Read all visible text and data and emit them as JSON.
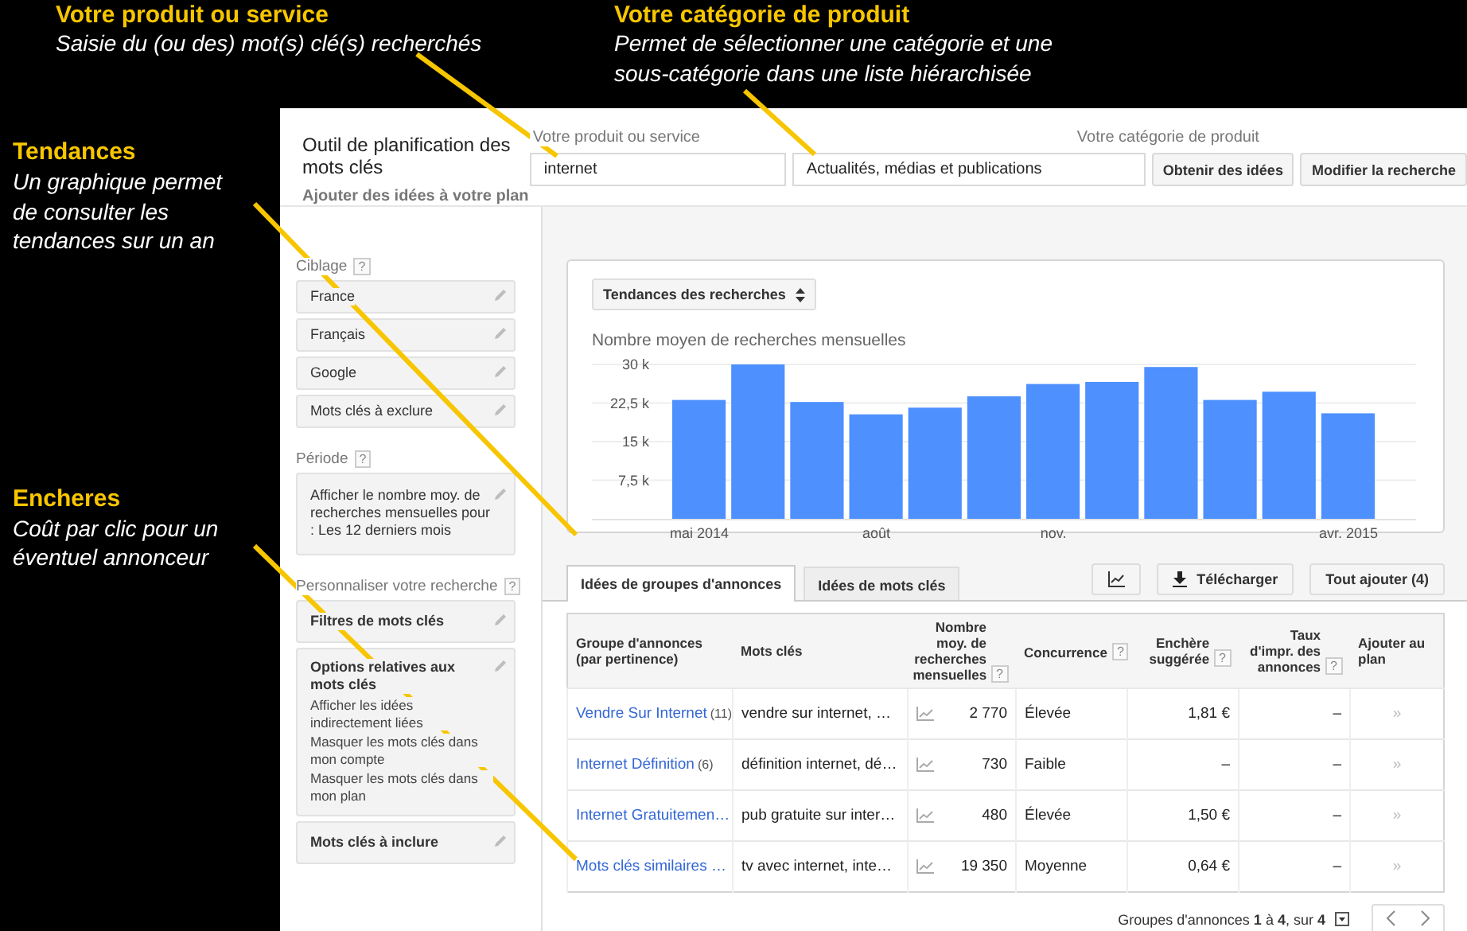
{
  "top_annotations": [
    {
      "title": "Votre produit ou service",
      "text": "Saisie du (ou des) mot(s) clé(s) recherchés"
    },
    {
      "title": "Votre catégorie de produit",
      "text": "Permet de sélectionner une catégorie et une sous-catégorie dans une liste hiérarchisée"
    }
  ],
  "side_annotations": [
    {
      "title": "Tendances",
      "text": "Un graphique permet de consulter les tendances sur un an"
    },
    {
      "title": "Encheres",
      "text": "Coût par clic pour un éventuel annonceur"
    }
  ],
  "header": {
    "title": "Outil de planification des mots clés",
    "subtitle": "Ajouter des idées à votre plan"
  },
  "search": {
    "product_label": "Votre produit ou service",
    "product_value": "internet",
    "category_label": "Votre catégorie de produit",
    "category_value": "Actualités, médias et publications",
    "buttons": [
      "Obtenir des idées",
      "Modifier la recherche"
    ]
  },
  "sidebar": {
    "sections": [
      {
        "title": "Ciblage",
        "help": "?",
        "items": [
          {
            "kind": "plain",
            "label": "France"
          },
          {
            "kind": "plain",
            "label": "Français"
          },
          {
            "kind": "plain",
            "label": "Google"
          },
          {
            "kind": "plain",
            "label": "Mots clés à exclure"
          }
        ]
      },
      {
        "title": "Période",
        "help": "?",
        "items": [
          {
            "kind": "plain",
            "label": "Afficher le nombre moy. de recherches mensuelles pour : Les 12 derniers mois"
          }
        ]
      },
      {
        "title": "Personnaliser votre recherche",
        "help": "?",
        "items": [
          {
            "kind": "bold",
            "label": "Filtres de mots clés"
          },
          {
            "kind": "options",
            "label": "Options relatives aux mots clés",
            "lines": [
              "Afficher les idées indirectement liées",
              "Masquer les mots clés dans mon compte",
              "Masquer les mots clés dans mon plan"
            ]
          },
          {
            "kind": "bold",
            "label": "Mots clés à inclure"
          }
        ]
      }
    ]
  },
  "chart": {
    "selector": "Tendances des recherches",
    "chart_data": {
      "type": "bar",
      "title": "Nombre moyen de recherches mensuelles",
      "categories": [
        "mai 2014",
        null,
        null,
        "août",
        null,
        null,
        "nov.",
        null,
        null,
        null,
        null,
        "avr. 2015"
      ],
      "series": [
        {
          "color": "#4d90fe",
          "values": [
            23.1,
            30,
            22.7,
            20.3,
            21.6,
            23.8,
            26.2,
            26.6,
            29.5,
            23.1,
            24.7,
            20.5
          ]
        }
      ],
      "ylim": [
        0,
        30
      ],
      "grid": true,
      "yticks": [
        {
          "value": 7.5,
          "label": "7,5 k"
        },
        {
          "value": 15,
          "label": "15 k"
        },
        {
          "value": 22.5,
          "label": "22,5 k"
        },
        {
          "value": 30,
          "label": "30 k"
        }
      ]
    }
  },
  "tabs": [
    {
      "label": "Idées de groupes d'annonces",
      "selected": true
    },
    {
      "label": "Idées de mots clés",
      "selected": false
    }
  ],
  "toolbar": {
    "download": "Télécharger",
    "add_all": "Tout ajouter (4)"
  },
  "table": {
    "columns": [
      {
        "label": "Groupe d'annonces (par pertinence)"
      },
      {
        "label": "Mots clés"
      },
      {
        "label": "Nombre moy. de recherches mensuelles",
        "help": "?"
      },
      {
        "label": "Concurrence",
        "help": "?"
      },
      {
        "label": "Enchère suggérée",
        "help": "?"
      },
      {
        "label": "Taux d'impr. des annonces",
        "help": "?"
      },
      {
        "label": "Ajouter au plan"
      }
    ],
    "rows": [
      {
        "group": "Vendre Sur Internet",
        "count": "(11)",
        "keywords": "vendre sur internet, …",
        "searches": "2 770",
        "competition": "Élevée",
        "bid": "1,81 €",
        "impression_share": "–",
        "add": "»"
      },
      {
        "group": "Internet Définition",
        "count": "(6)",
        "keywords": "définition internet, dé…",
        "searches": "730",
        "competition": "Faible",
        "bid": "–",
        "impression_share": "–",
        "add": "»"
      },
      {
        "group": "Internet Gratuitemen…",
        "keywords": "pub gratuite sur inter…",
        "searches": "480",
        "competition": "Élevée",
        "bid": "1,50 €",
        "impression_share": "–",
        "add": "»"
      },
      {
        "group": "Mots clés similaires …",
        "keywords": "tv avec internet, inte…",
        "searches": "19 350",
        "competition": "Moyenne",
        "bid": "0,64 €",
        "impression_share": "–",
        "add": "»"
      }
    ]
  },
  "pagination": {
    "text": "Groupes d'annonces **1** à **4**, sur **4**"
  }
}
